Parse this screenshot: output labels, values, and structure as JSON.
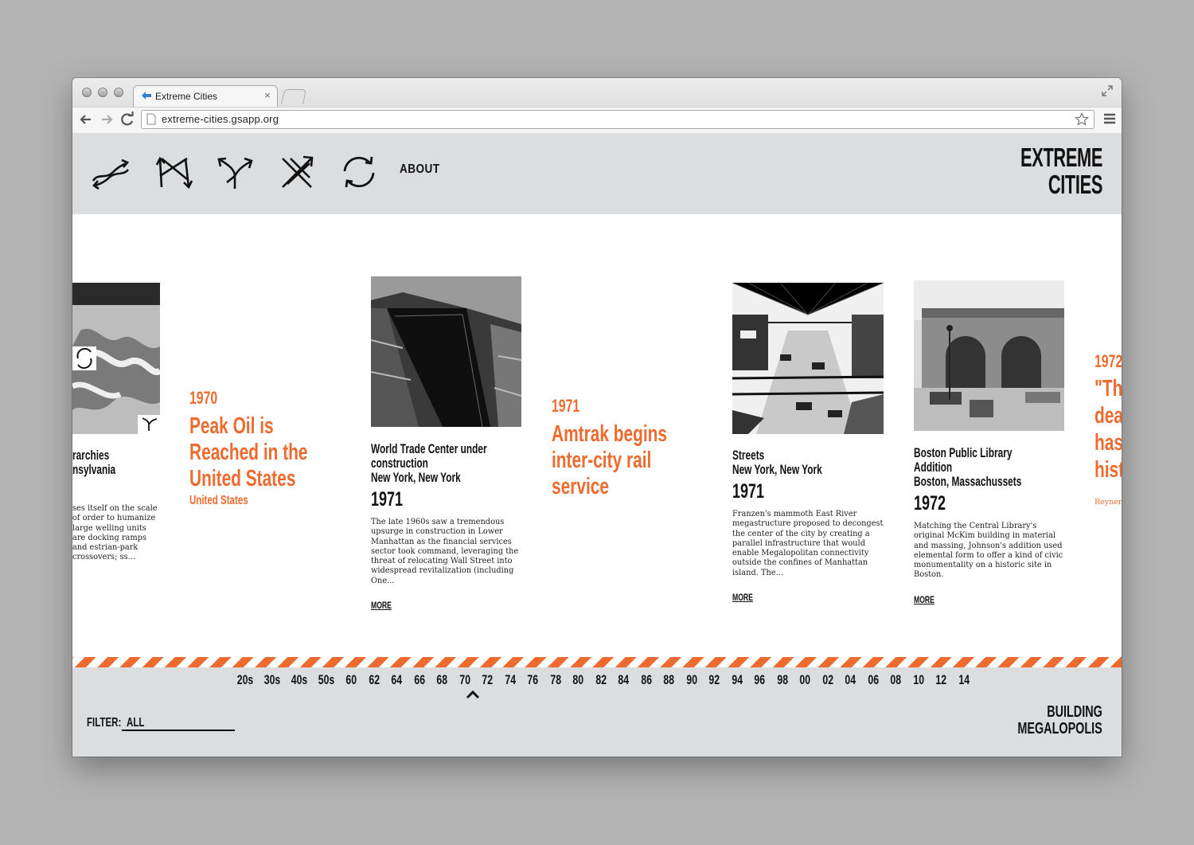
{
  "browser": {
    "tab_title": "Extreme Cities",
    "url": "extreme-cities.gsapp.org"
  },
  "header": {
    "filter_icons": [
      "swap-arrows-icon",
      "zigzag-arrows-icon",
      "branch-arrows-icon",
      "crossed-arrows-icon",
      "cycle-arrows-icon"
    ],
    "about_label": "ABOUT",
    "logo_line1": "EXTREME",
    "logo_line2": "CITIES"
  },
  "timeline": {
    "partial_card": {
      "title_line1": "rarchies",
      "title_line2": "nsylvania",
      "desc": "ses itself on the scale of order to humanize large welling units are docking ramps and estrian-park crossovers; ss..."
    },
    "cards": [
      {
        "title_lines": [
          "World Trade Center under",
          "construction",
          "New York, New York"
        ],
        "year": "1971",
        "desc": "The late 1960s saw a tremendous upsurge in construction in Lower Manhattan as the financial services sector took command, leveraging the threat of relocating Wall Street into widespread revitalization (including One...",
        "more": "MORE"
      },
      {
        "title_lines": [
          "Streets",
          "New York, New York"
        ],
        "year": "1971",
        "desc": "Franzen's mammoth East River megastructure proposed to decongest the center of the city by creating a parallel infrastructure that would enable Megalopolitan connectivity outside the confines of Manhattan island. The...",
        "more": "MORE"
      },
      {
        "title_lines": [
          "Boston Public Library",
          "Addition",
          "Boston, Massachussets"
        ],
        "year": "1972",
        "desc": "Matching the Central Library's original McKim building in material and massing, Johnson's addition used elemental form to offer a kind of civic monumentality on a historic site in Boston.",
        "more": "MORE"
      }
    ],
    "events": [
      {
        "year": "1970",
        "title": "Peak Oil is Reached in the United States",
        "location": "United States"
      },
      {
        "year": "1971",
        "title": "Amtrak begins inter-city rail service"
      }
    ],
    "partial_event": {
      "year": "1972",
      "title_lines": [
        "\"The",
        "dead",
        "has",
        "histo"
      ],
      "author": "Reyner"
    },
    "accent_color": "#ee6b2f"
  },
  "footer": {
    "decades": [
      "20s",
      "30s",
      "40s",
      "50s",
      "60",
      "62",
      "64",
      "66",
      "68",
      "70",
      "72",
      "74",
      "76",
      "78",
      "80",
      "82",
      "84",
      "86",
      "88",
      "90",
      "92",
      "94",
      "96",
      "98",
      "00",
      "02",
      "04",
      "06",
      "08",
      "10",
      "12",
      "14"
    ],
    "selected_decade": "72",
    "filter_label": "FILTER:",
    "filter_value": "ALL",
    "section_line1": "BUILDING",
    "section_line2": "MEGALOPOLIS"
  }
}
